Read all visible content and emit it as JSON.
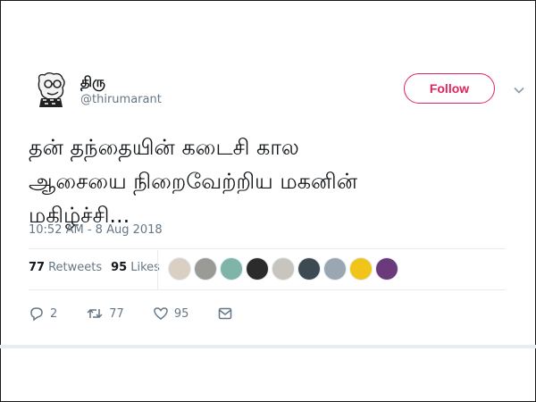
{
  "user": {
    "name": "திரு",
    "handle": "@thirumarant"
  },
  "follow_label": "Follow",
  "tweet": {
    "lines": [
      "தன் தந்தையின் கடைசி கால",
      "ஆசையை நிறைவேற்றிய மகனின்",
      "மகிழ்ச்சி..."
    ],
    "timestamp": "10:52 AM - 8 Aug 2018"
  },
  "stats": {
    "retweets_count": "77",
    "retweets_label": "Retweets",
    "likes_count": "95",
    "likes_label": "Likes"
  },
  "liker_colors": [
    "#d9cfc2",
    "#9a9a96",
    "#7fb5a8",
    "#2b2b2b",
    "#c8c4be",
    "#3d4a52",
    "#9aa6b2",
    "#f0c419",
    "#6a3a7a"
  ],
  "actions": {
    "reply_count": "2",
    "retweet_count": "77",
    "like_count": "95"
  },
  "colors": {
    "follow_accent": "#e0245e",
    "muted_text": "#657786"
  }
}
